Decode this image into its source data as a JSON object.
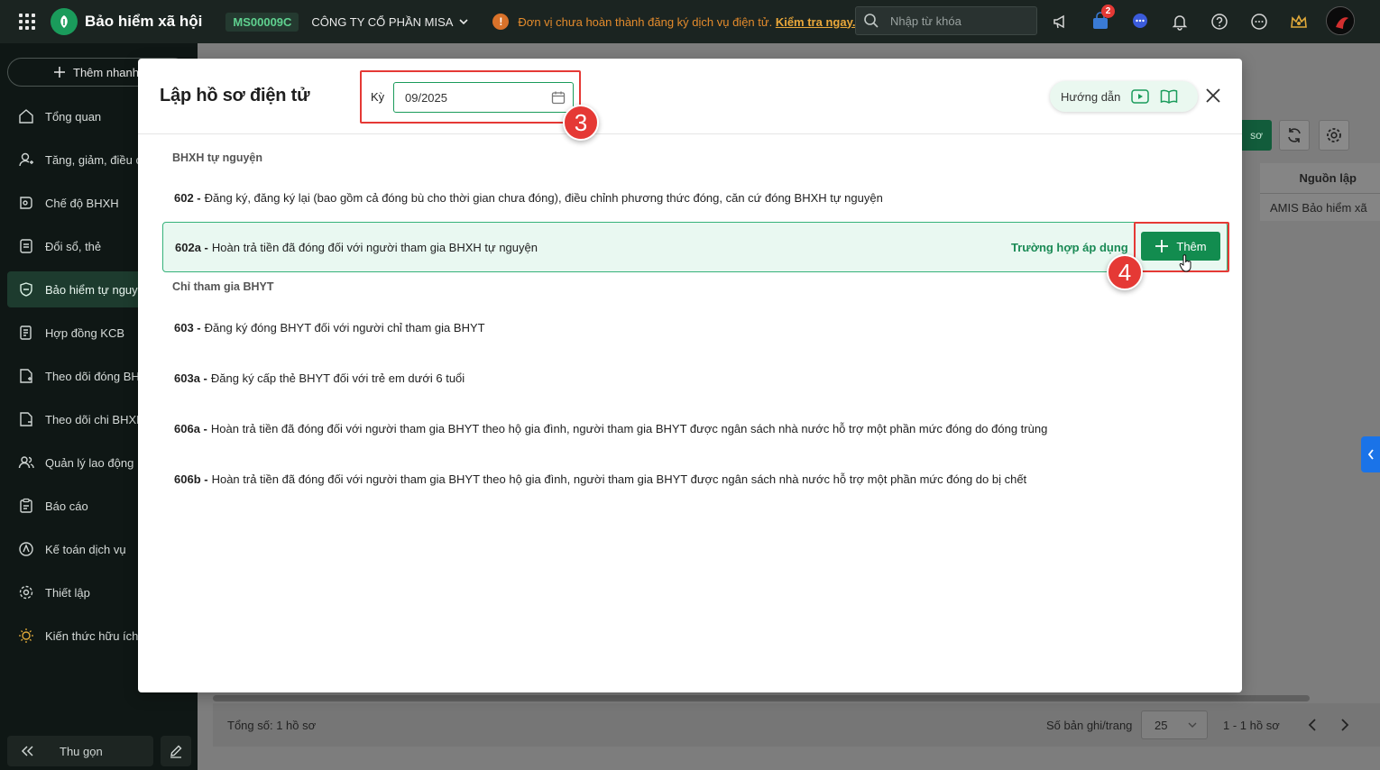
{
  "topbar": {
    "app_title": "Bảo hiểm xã hội",
    "company_code": "MS00009C",
    "company_name": "CÔNG TY CỔ PHẦN MISA",
    "warning_text": "Đơn vị chưa hoàn thành đăng ký dịch vụ điện tử.",
    "warning_link": "Kiểm tra ngay.",
    "search_placeholder": "Nhập từ khóa",
    "cart_badge": "2",
    "icons": [
      "megaphone-icon",
      "cart-icon",
      "chat-icon",
      "bell-icon",
      "help-icon",
      "more-icon",
      "crown-icon"
    ]
  },
  "sidebar": {
    "quick_add": "Thêm nhanh",
    "items": [
      {
        "label": "Tổng quan",
        "icon": "home-icon"
      },
      {
        "label": "Tăng, giảm, điều chỉnh",
        "icon": "user-adjust-icon"
      },
      {
        "label": "Chế độ BHXH",
        "icon": "benefit-icon"
      },
      {
        "label": "Đổi sổ, thẻ",
        "icon": "card-icon"
      },
      {
        "label": "Bảo hiểm tự nguyện",
        "icon": "shield-icon"
      },
      {
        "label": "Hợp đồng KCB",
        "icon": "contract-icon"
      },
      {
        "label": "Theo dõi đóng BHXH",
        "icon": "doc-track-icon"
      },
      {
        "label": "Theo dõi chi BHXH",
        "icon": "doc-pay-icon"
      },
      {
        "label": "Quản lý lao động",
        "icon": "people-icon"
      },
      {
        "label": "Báo cáo",
        "icon": "report-icon"
      },
      {
        "label": "Kế toán dịch vụ",
        "icon": "accounting-icon"
      },
      {
        "label": "Thiết lập",
        "icon": "settings-icon"
      },
      {
        "label": "Kiến thức hữu ích",
        "icon": "knowledge-icon"
      }
    ],
    "collapse_label": "Thu gọn"
  },
  "background": {
    "green_button_suffix": "sơ",
    "column_header": "Nguồn lập",
    "cell_value": "AMIS Bảo hiểm xã",
    "total": "Tổng số: 1 hồ sơ",
    "per_page_label": "Số bản ghi/trang",
    "per_page_value": "25",
    "range": "1 - 1 hồ sơ"
  },
  "modal": {
    "title": "Lập hồ sơ điện tử",
    "period_label": "Kỳ",
    "period_value": "09/2025",
    "guide_label": "Hướng dẫn",
    "step_period": "3",
    "step_add": "4",
    "groups": [
      {
        "title": "BHXH tự nguyện",
        "items": [
          {
            "code": "602 -",
            "text": "Đăng ký, đăng ký lại (bao gồm cả đóng bù cho thời gian chưa đóng), điều chỉnh phương thức đóng, căn cứ đóng BHXH tự nguyện"
          },
          {
            "code": "602a -",
            "text": "Hoàn trả tiền đã đóng đối với người tham gia BHXH tự nguyện",
            "apply_link": "Trường hợp áp dụng",
            "add_label": "Thêm"
          }
        ]
      },
      {
        "title": "Chỉ tham gia BHYT",
        "items": [
          {
            "code": "603 -",
            "text": "Đăng ký đóng BHYT đối với người chỉ tham gia BHYT"
          },
          {
            "code": "603a -",
            "text": "Đăng ký cấp thẻ BHYT đối với trẻ em dưới 6 tuổi"
          },
          {
            "code": "606a -",
            "text": "Hoàn trả tiền đã đóng đối với người tham gia BHYT theo hộ gia đình, người tham gia BHYT được ngân sách nhà nước hỗ trợ một phần mức đóng do đóng trùng"
          },
          {
            "code": "606b -",
            "text": "Hoàn trả tiền đã đóng đối với người tham gia BHYT theo hộ gia đình, người tham gia BHYT được ngân sách nhà nước hỗ trợ một phần mức đóng do bị chết"
          }
        ]
      }
    ]
  },
  "colors": {
    "brand_green": "#128c4f",
    "highlight_bg": "#e9f8f1",
    "annotation_red": "#e53935",
    "warning_orange": "#e48b2c"
  }
}
